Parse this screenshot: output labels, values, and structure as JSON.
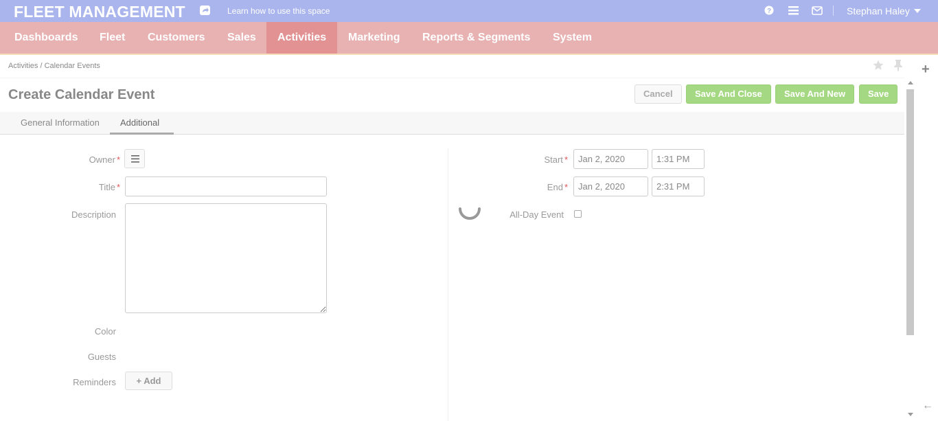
{
  "app": {
    "title": "FLEET MANAGEMENT",
    "learn_link": "Learn how to use this space",
    "user_name": "Stephan Haley",
    "icons": [
      "share-icon",
      "help-icon",
      "menu-icon",
      "mail-icon",
      "caret-down-icon"
    ]
  },
  "nav": {
    "items": [
      {
        "label": "Dashboards"
      },
      {
        "label": "Fleet"
      },
      {
        "label": "Customers"
      },
      {
        "label": "Sales"
      },
      {
        "label": "Activities"
      },
      {
        "label": "Marketing"
      },
      {
        "label": "Reports & Segments"
      },
      {
        "label": "System"
      }
    ],
    "active": "Activities"
  },
  "breadcrumb": {
    "text": "Activities / Calendar Events"
  },
  "page": {
    "title": "Create Calendar Event",
    "buttons": {
      "cancel": "Cancel",
      "save_close": "Save And Close",
      "save_new": "Save And New",
      "save": "Save"
    }
  },
  "tabs": [
    {
      "label": "General Information"
    },
    {
      "label": "Additional"
    }
  ],
  "active_tab": "Additional",
  "form": {
    "left": {
      "owner_label": "Owner",
      "title_label": "Title",
      "title_value": "",
      "description_label": "Description",
      "description_value": "",
      "color_label": "Color",
      "guests_label": "Guests",
      "reminders_label": "Reminders",
      "add_button": "+ Add"
    },
    "right": {
      "start_label": "Start",
      "start_date": "Jan 2, 2020",
      "start_time": "1:31 PM",
      "end_label": "End",
      "end_date": "Jan 2, 2020",
      "end_time": "2:31 PM",
      "allday_label": "All-Day Event",
      "allday_checked": false
    },
    "required_marker": "*"
  },
  "colors": {
    "topbar": "#a9b5ec",
    "nav": "#e8b2b3",
    "nav_active": "#e29293",
    "save_buttons": "#a5d882",
    "required": "#e05555"
  }
}
